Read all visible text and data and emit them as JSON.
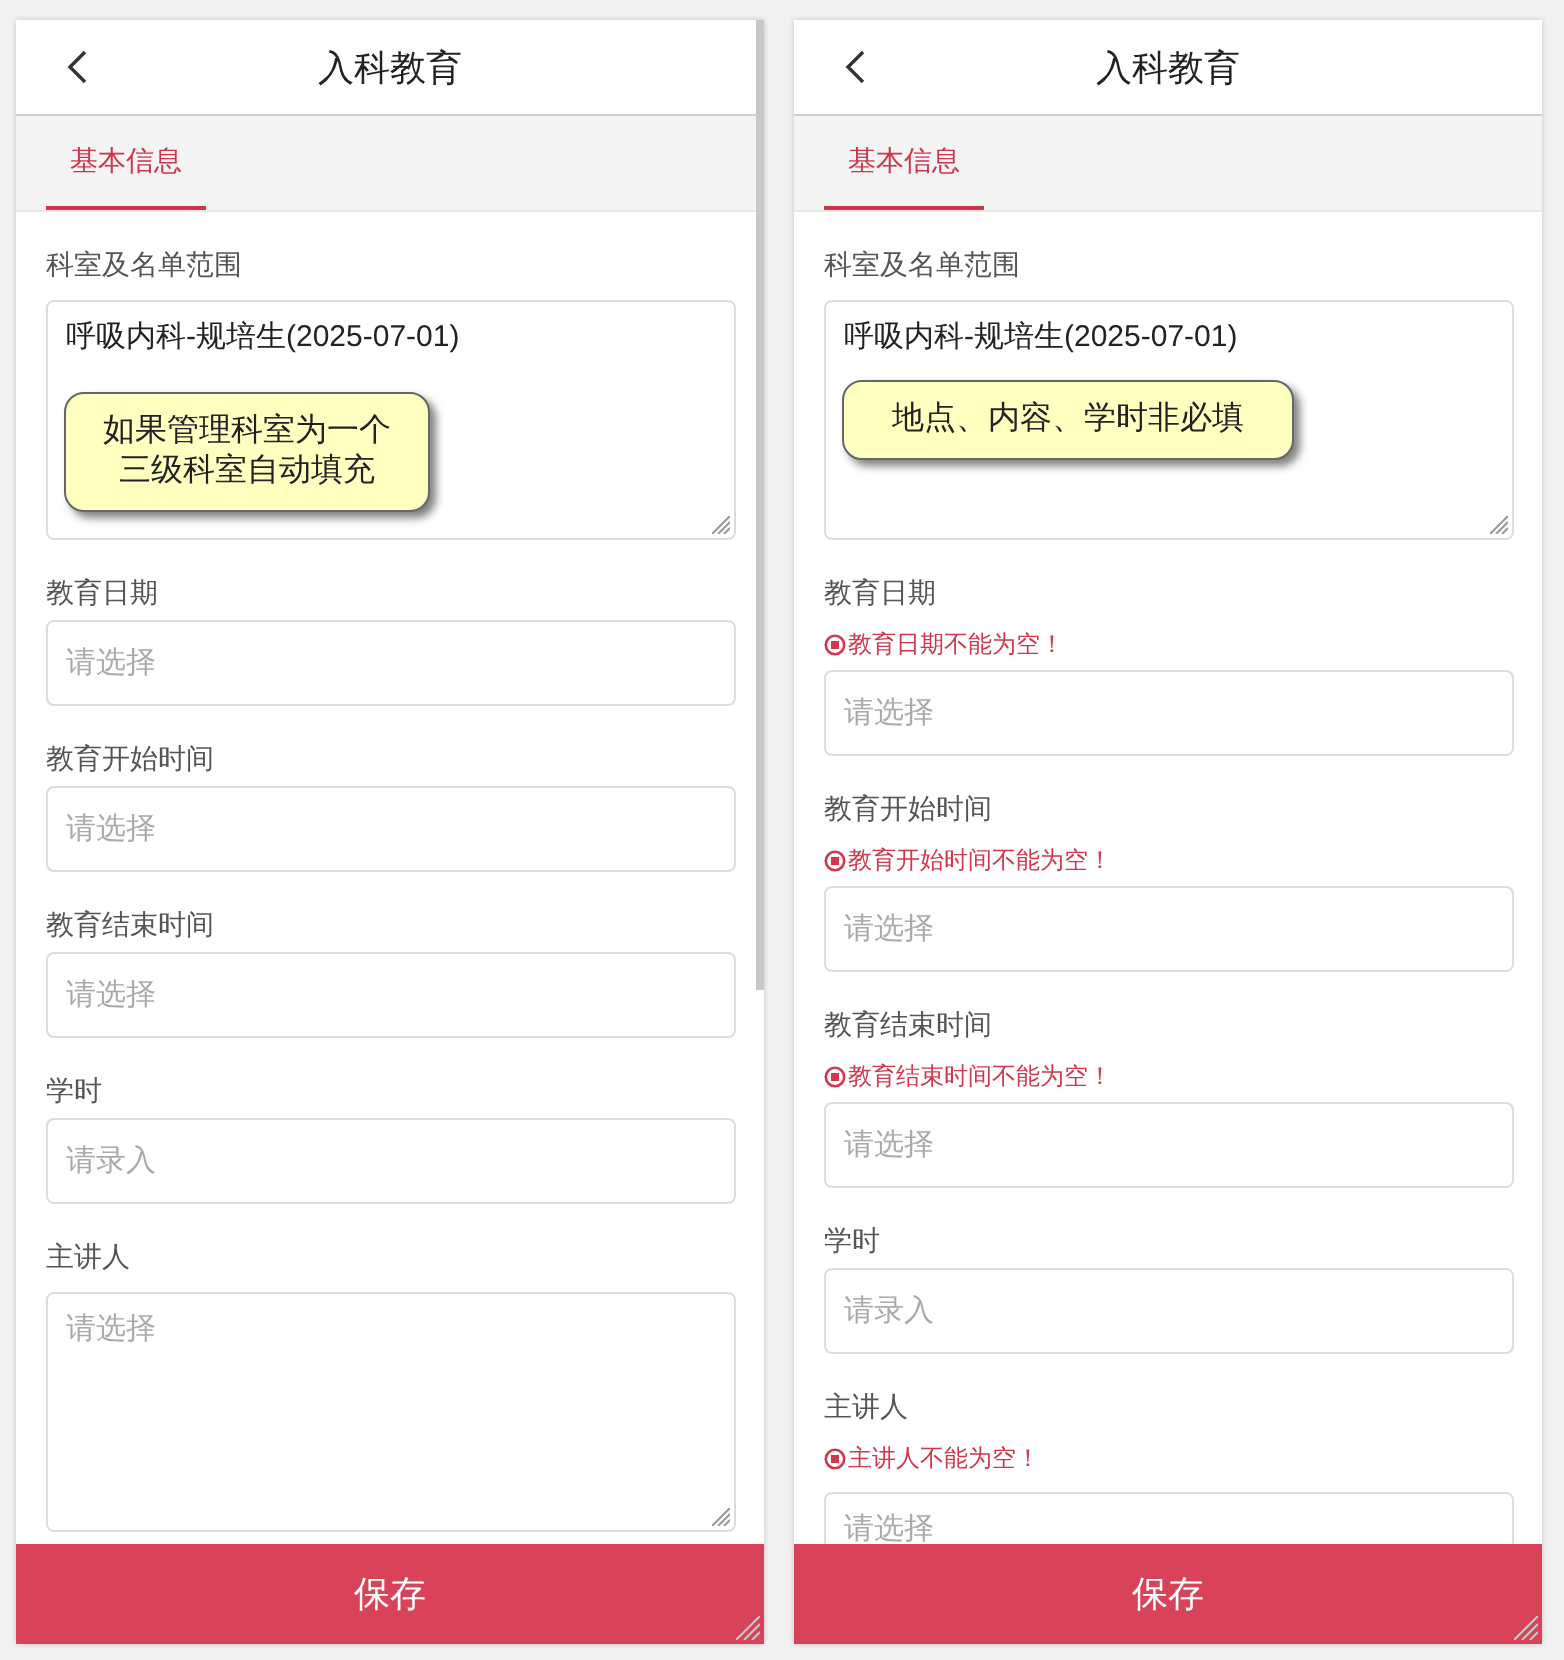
{
  "panels": [
    {
      "header": {
        "title": "入科教育"
      },
      "tabs": [
        {
          "label": "基本信息",
          "selected": true
        }
      ],
      "scrollbar": true,
      "fields": [
        {
          "kind": "textarea",
          "label": "科室及名单范围",
          "value": "呼吸内科-规培生(2025-07-01)",
          "note": "如果管理科室为一个三级科室自动填充",
          "grip": true
        },
        {
          "kind": "input",
          "label": "教育日期",
          "placeholder": "请选择"
        },
        {
          "kind": "input",
          "label": "教育开始时间",
          "placeholder": "请选择"
        },
        {
          "kind": "input",
          "label": "教育结束时间",
          "placeholder": "请选择"
        },
        {
          "kind": "input",
          "label": "学时",
          "placeholder": "请录入"
        },
        {
          "kind": "textarea",
          "label": "主讲人",
          "placeholder": "请选择",
          "grip": true
        }
      ],
      "save_button": "保存"
    },
    {
      "header": {
        "title": "入科教育"
      },
      "tabs": [
        {
          "label": "基本信息",
          "selected": true
        }
      ],
      "scrollbar": false,
      "fields": [
        {
          "kind": "textarea",
          "label": "科室及名单范围",
          "value": "呼吸内科-规培生(2025-07-01)",
          "note": "地点、内容、学时非必填",
          "grip": true
        },
        {
          "kind": "input",
          "label": "教育日期",
          "error": "教育日期不能为空！",
          "placeholder": "请选择"
        },
        {
          "kind": "input",
          "label": "教育开始时间",
          "error": "教育开始时间不能为空！",
          "placeholder": "请选择"
        },
        {
          "kind": "input",
          "label": "教育结束时间",
          "error": "教育结束时间不能为空！",
          "placeholder": "请选择"
        },
        {
          "kind": "input",
          "label": "学时",
          "placeholder": "请录入"
        },
        {
          "kind": "textarea",
          "label": "主讲人",
          "error": "主讲人不能为空！",
          "placeholder": "请选择",
          "grip": false
        }
      ],
      "save_button": "保存"
    }
  ]
}
